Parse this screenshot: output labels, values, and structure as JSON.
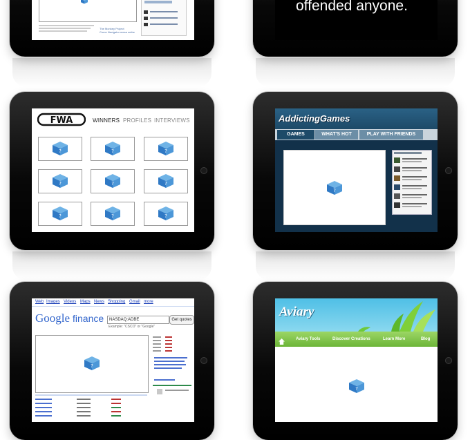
{
  "tile1": {
    "caption_line1": "The Monkey Project",
    "caption_line2": "Come Navigator mesa outbe"
  },
  "tile2": {
    "headline": "offended anyone."
  },
  "fwa": {
    "nav": [
      "WINNERS",
      "PROFILES",
      "INTERVIEWS"
    ]
  },
  "addicting_games": {
    "logo": "AddictingGames",
    "tabs": [
      "GAMES",
      "WHAT'S HOT",
      "PLAY WITH FRIENDS"
    ]
  },
  "google_finance": {
    "top_links": [
      "Web",
      "Images",
      "Videos",
      "Maps",
      "News",
      "Shopping",
      "Gmail",
      "more"
    ],
    "logo_google": "Google",
    "logo_finance": "finance",
    "search_value": "NASDAQ:ADBE",
    "button": "Get quotes",
    "example": "Example: \"CSCO\" or \"Google\""
  },
  "aviary": {
    "logo": "Aviary",
    "nav": [
      "Aviary Tools",
      "Discover Creations",
      "Learn More",
      "Blog"
    ]
  },
  "colors": {
    "ag_header": "#1d4a68",
    "ag_body": "#12314a",
    "aviary_sky": "#5ec8e8",
    "aviary_bar": "#7cc24b"
  }
}
